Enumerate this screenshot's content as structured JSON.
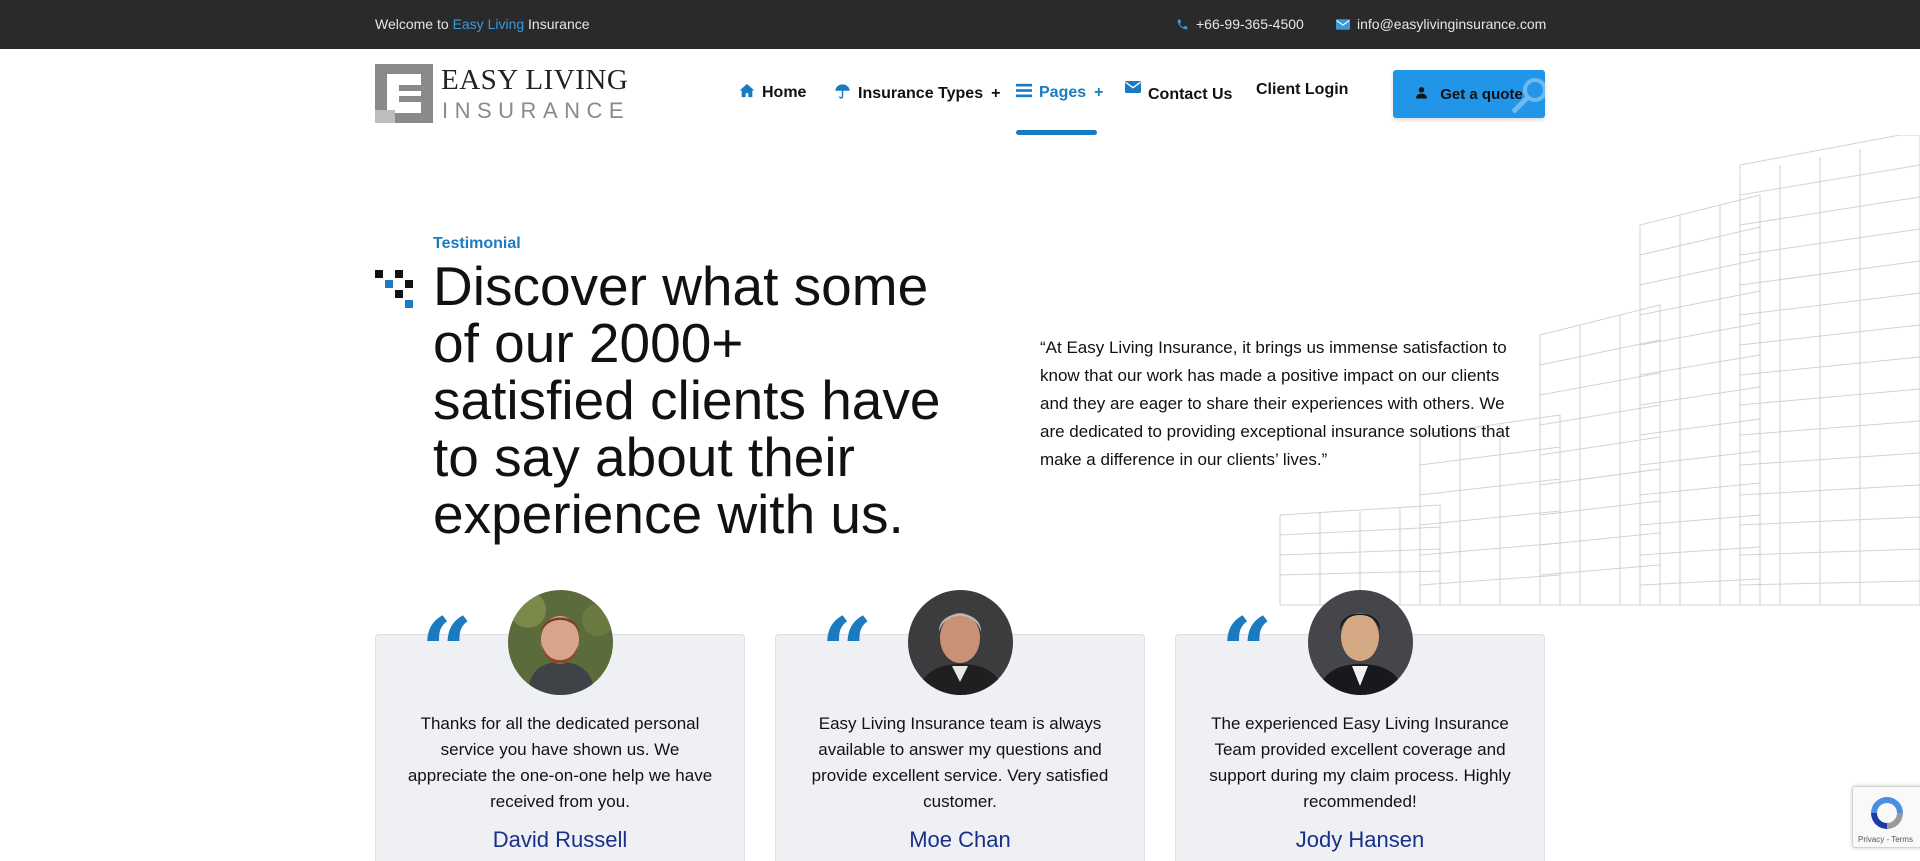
{
  "topbar": {
    "welcome_prefix": "Welcome to",
    "welcome_brand": "Easy Living",
    "welcome_suffix": "Insurance",
    "phone": "+66-99-365-4500",
    "email": "info@easylivinginsurance.com"
  },
  "logo": {
    "line1": "EASY LIVING",
    "line2": "INSURANCE"
  },
  "nav": {
    "home": "Home",
    "insurance_types": "Insurance Types",
    "pages": "Pages",
    "contact": "Contact Us",
    "client_login": "Client Login",
    "plus": "+"
  },
  "cta": {
    "quote": "Get a quote"
  },
  "section": {
    "eyebrow": "Testimonial",
    "headline": "Discover what some of our 2000+ satisfied clients have to say about their experience with us.",
    "lead": "“At Easy Living Insurance, it brings us immense satisfaction to know that our work has made a positive impact on our clients and they are eager to share their experiences with others. We are dedicated to providing exceptional insurance solutions that make a difference in our clients’ lives.”"
  },
  "testimonials": [
    {
      "text": "Thanks for all the dedicated personal service you have shown us. We appreciate the one-on-one help we have received from you.",
      "name": "David Russell"
    },
    {
      "text": "Easy Living Insurance team is always available to answer my questions and provide excellent service. Very satisfied customer.",
      "name": "Moe Chan"
    },
    {
      "text": "The experienced Easy Living Insurance Team provided excellent coverage and support during my claim process. Highly recommended!",
      "name": "Jody Hansen"
    }
  ],
  "quote_glyph": "“",
  "recaptcha": {
    "terms": "Privacy - Terms"
  },
  "colors": {
    "accent": "#1a7bc1",
    "button": "#2196e8",
    "topbar": "#2a2a2a",
    "name": "#1a2f8a",
    "card": "#eef0f3"
  }
}
